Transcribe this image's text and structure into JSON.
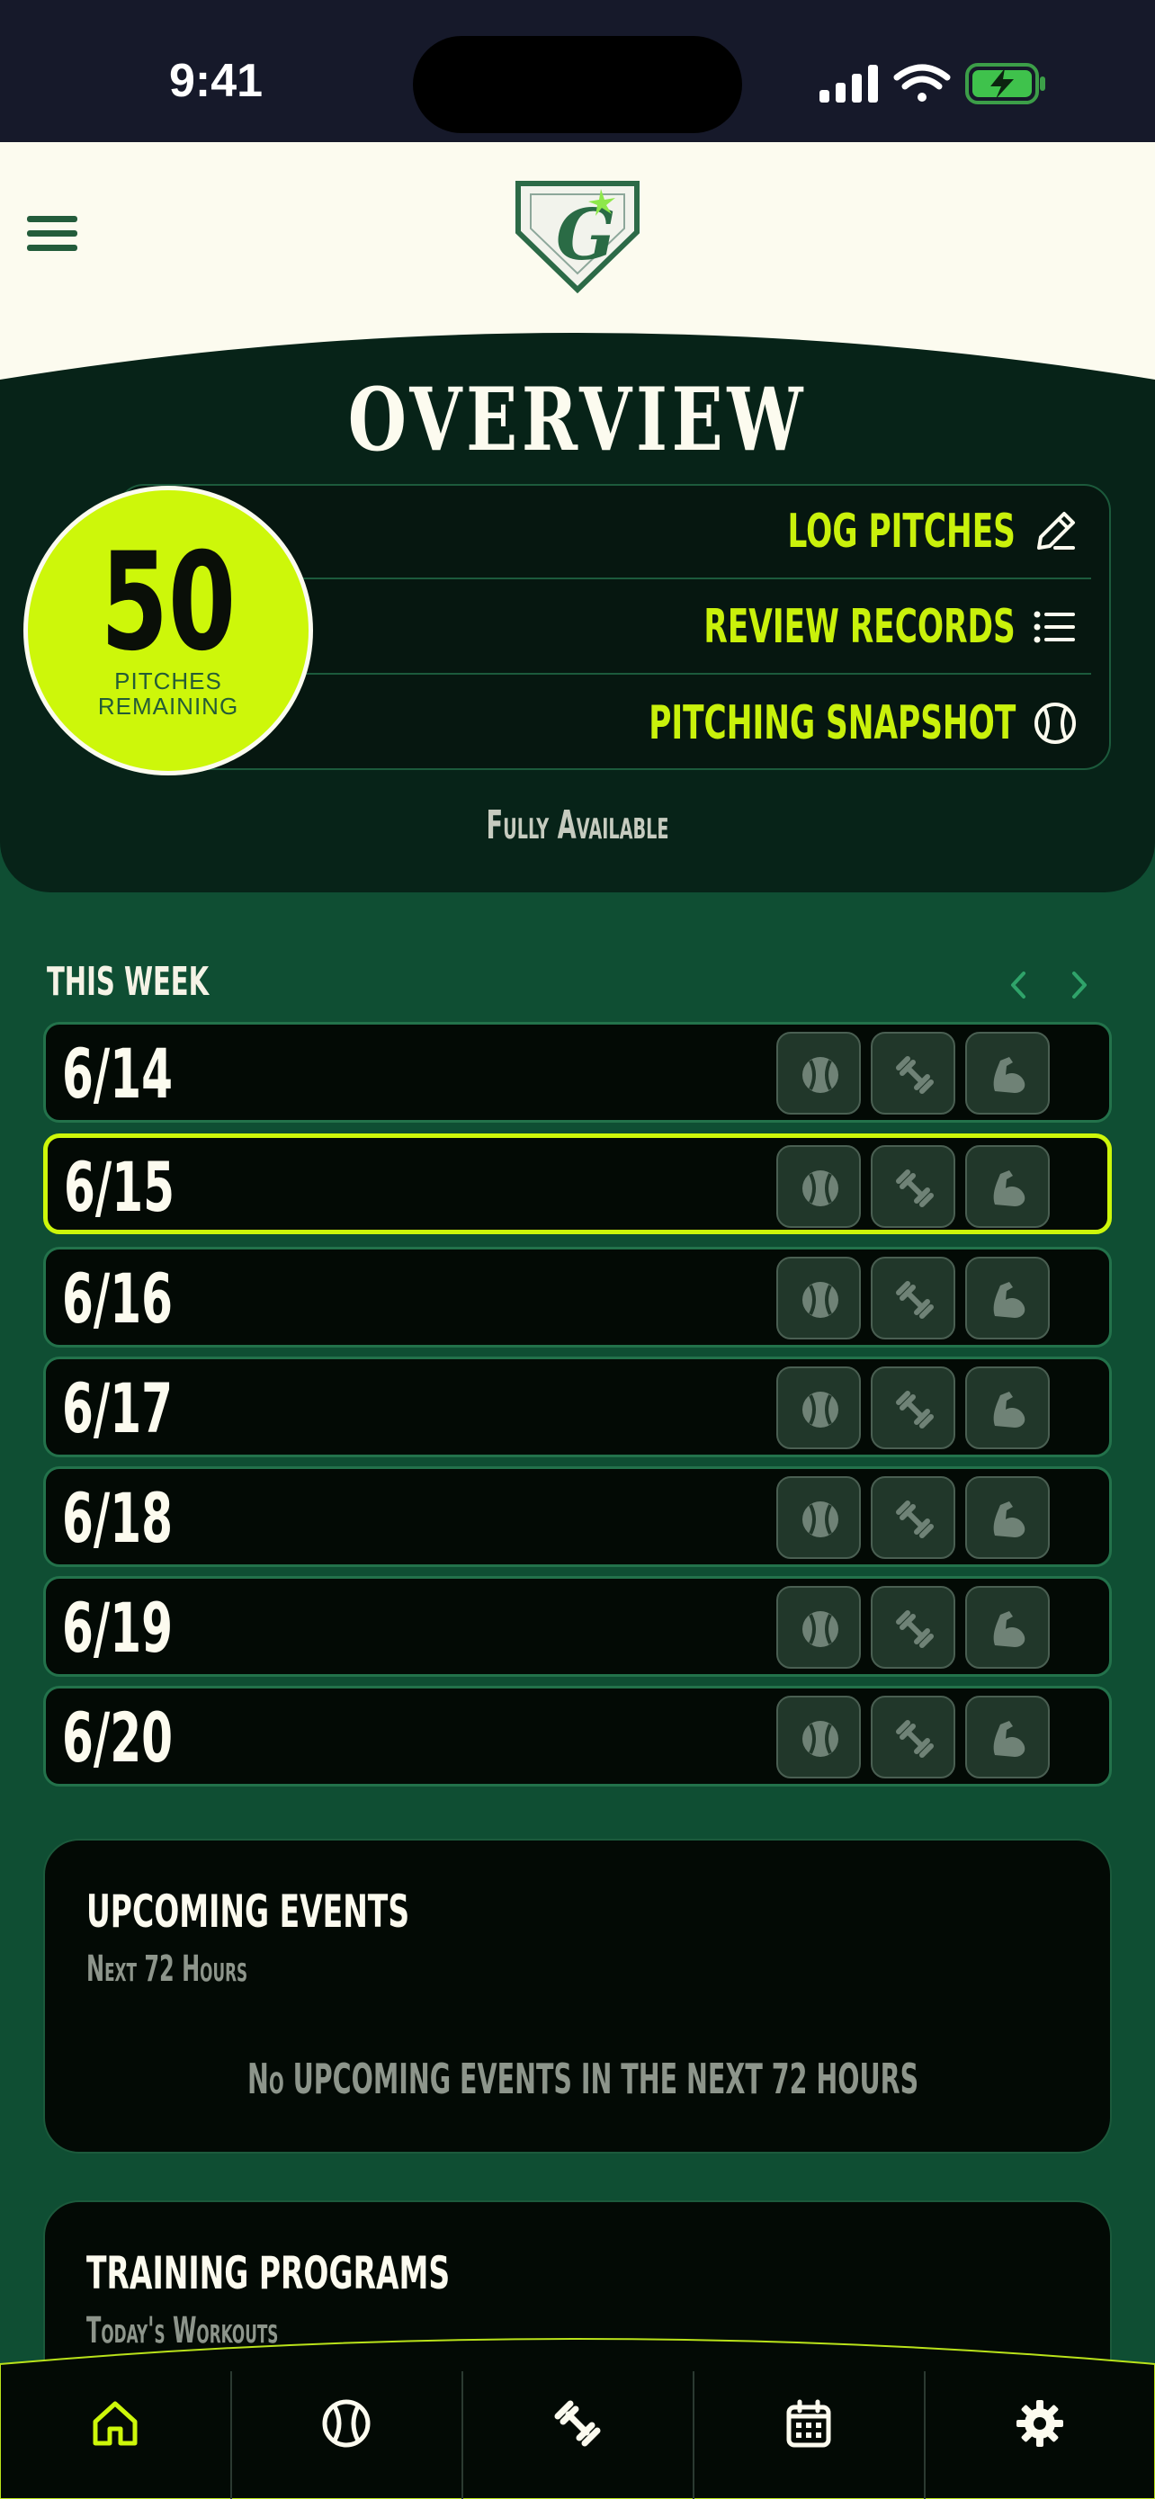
{
  "status_bar": {
    "time": "9:41"
  },
  "overview": {
    "title": "OVERVIEW",
    "pitch_count": "50",
    "pitch_label_line1": "PITCHES",
    "pitch_label_line2": "REMAINING",
    "actions": [
      {
        "label": "LOG PITCHES",
        "icon": "pencil-icon"
      },
      {
        "label": "REVIEW RECORDS",
        "icon": "list-icon"
      },
      {
        "label": "PITCHING SNAPSHOT",
        "icon": "baseball-icon"
      }
    ],
    "availability": "Fully Available"
  },
  "week": {
    "title": "THIS WEEK",
    "days": [
      {
        "date": "6/14",
        "selected": false
      },
      {
        "date": "6/15",
        "selected": true
      },
      {
        "date": "6/16",
        "selected": false
      },
      {
        "date": "6/17",
        "selected": false
      },
      {
        "date": "6/18",
        "selected": false
      },
      {
        "date": "6/19",
        "selected": false
      },
      {
        "date": "6/20",
        "selected": false
      }
    ],
    "day_icons": [
      "baseball-icon",
      "dumbbell-icon",
      "muscle-icon"
    ]
  },
  "upcoming_events": {
    "title": "UPCOMING EVENTS",
    "subtitle": "Next 72 Hours",
    "empty_message": "No UPCOMING EVENTS IN THE NEXT 72 HOURS"
  },
  "training_programs": {
    "title": "TRAINING PROGRAMS",
    "subtitle": "Today's Workouts"
  },
  "tabbar": {
    "tabs": [
      "home-icon",
      "baseball-icon",
      "dumbbell-icon",
      "calendar-icon",
      "gear-icon"
    ],
    "active_index": 0
  },
  "colors": {
    "accent": "#cdf70a",
    "background": "#0f4e33",
    "panel": "#072318",
    "cream": "#fcfbef"
  }
}
